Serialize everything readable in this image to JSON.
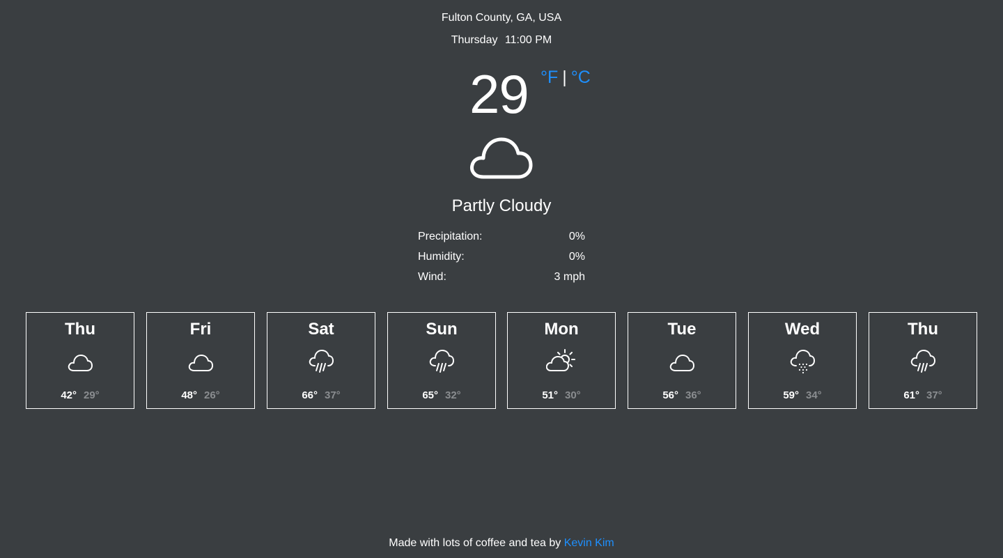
{
  "location": "Fulton County, GA, USA",
  "current": {
    "day": "Thursday",
    "time": "11:00 PM",
    "temperature": "29",
    "unit_f": "°F",
    "unit_separator": "|",
    "unit_c": "°C",
    "icon": "cloud-icon",
    "summary": "Partly Cloudy",
    "details": [
      {
        "label": "Precipitation:",
        "value": "0%"
      },
      {
        "label": "Humidity:",
        "value": "0%"
      },
      {
        "label": "Wind:",
        "value": "3 mph"
      }
    ]
  },
  "forecast": [
    {
      "day": "Thu",
      "icon": "cloud-icon",
      "high": "42°",
      "low": "29°"
    },
    {
      "day": "Fri",
      "icon": "cloud-icon",
      "high": "48°",
      "low": "26°"
    },
    {
      "day": "Sat",
      "icon": "rain-icon",
      "high": "66°",
      "low": "37°"
    },
    {
      "day": "Sun",
      "icon": "rain-icon",
      "high": "65°",
      "low": "32°"
    },
    {
      "day": "Mon",
      "icon": "partly-sunny-icon",
      "high": "51°",
      "low": "30°"
    },
    {
      "day": "Tue",
      "icon": "cloud-icon",
      "high": "56°",
      "low": "36°"
    },
    {
      "day": "Wed",
      "icon": "sleet-icon",
      "high": "59°",
      "low": "34°"
    },
    {
      "day": "Thu",
      "icon": "rain-icon",
      "high": "61°",
      "low": "37°"
    }
  ],
  "footer": {
    "text": "Made with lots of coffee and tea by",
    "author": "Kevin Kim"
  },
  "colors": {
    "background": "#3a3e41",
    "accent": "#1e90ff",
    "muted": "#8a8d90"
  }
}
